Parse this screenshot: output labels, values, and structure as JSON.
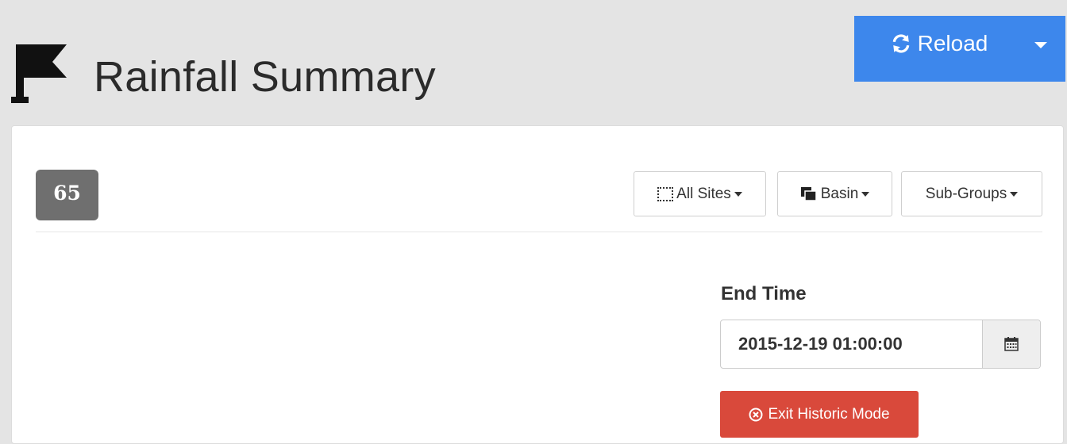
{
  "header": {
    "title": "Rainfall Summary",
    "title_icon": "flag-icon",
    "reload": {
      "label": "Reload",
      "icon": "refresh-icon",
      "caret_icon": "chevron-down-icon"
    }
  },
  "panel": {
    "count_badge": "65",
    "filters": [
      {
        "label": "All Sites",
        "icon": "selection-icon"
      },
      {
        "label": "Basin",
        "icon": "clone-icon"
      },
      {
        "label": "Sub-Groups",
        "icon": ""
      }
    ],
    "end_time": {
      "label": "End Time",
      "value": "2015-12-19 01:00:00",
      "icon": "calendar-icon"
    },
    "exit_button": {
      "label": "Exit Historic Mode",
      "icon": "close-circle-icon"
    }
  },
  "colors": {
    "primary": "#3d87ec",
    "danger": "#d9493b",
    "badge": "#6f6f6f",
    "background": "#e4e4e4"
  }
}
